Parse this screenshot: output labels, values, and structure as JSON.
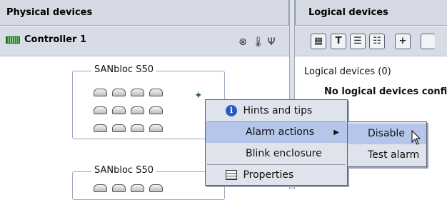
{
  "left_pane": {
    "header": "Physical devices",
    "controller_label": "Controller 1",
    "toolbar_icons": [
      "alarm-off-icon",
      "thermometer-icon",
      "fan-icon"
    ],
    "enclosures": [
      {
        "title": "SANbloc S50",
        "disk_rows": 3,
        "disk_cols": 4
      },
      {
        "title": "SANbloc S50"
      }
    ]
  },
  "right_pane": {
    "header": "Logical devices",
    "toolbar_icons": [
      "disk-icon",
      "text-icon",
      "list-icon",
      "list-alt-icon",
      "add-icon"
    ],
    "toolbar_glyphs": [
      "▦",
      "T",
      "☰",
      "☷",
      "+"
    ],
    "title": "Logical devices (0)",
    "message": "No logical devices confi"
  },
  "context_menu": {
    "items": [
      {
        "label": "Hints and tips",
        "icon": "info-icon"
      },
      {
        "label": "Alarm actions",
        "submenu": true,
        "selected": true
      },
      {
        "label": "Blink enclosure"
      },
      {
        "label": "Properties",
        "icon": "properties-icon"
      }
    ]
  },
  "submenu": {
    "items": [
      {
        "label": "Disable",
        "selected": true
      },
      {
        "label": "Test alarm"
      }
    ]
  },
  "colors": {
    "header_bg": "#d5d9e4",
    "menu_bg": "#dfe3ec",
    "selection": "#b5c6ea",
    "border": "#5a607a"
  }
}
